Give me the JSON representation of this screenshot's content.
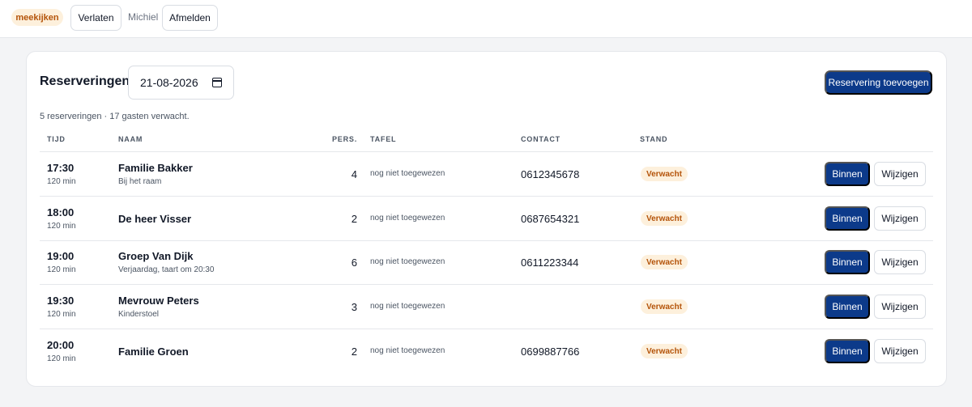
{
  "topbar": {
    "badge": "meekijken",
    "leave_label": "Verlaten",
    "user_name": "Michiel",
    "logout_label": "Afmelden"
  },
  "main": {
    "title": "Reserveringen",
    "date_value": "21-08-2026",
    "add_button": "Reservering toevoegen",
    "summary": "5 reserveringen · 17 gasten verwacht."
  },
  "table": {
    "headers": {
      "time": "TIJD",
      "name": "NAAM",
      "pers": "PERS.",
      "table": "TAFEL",
      "contact": "CONTACT",
      "status": "STAND"
    },
    "rows": [
      {
        "time": "17:30",
        "duration": "120 min",
        "name": "Familie Bakker",
        "note": "Bij het raam",
        "pers": "4",
        "table": "nog niet toegewezen",
        "contact": "0612345678",
        "status": "Verwacht",
        "in_label": "Binnen",
        "edit_label": "Wijzigen"
      },
      {
        "time": "18:00",
        "duration": "120 min",
        "name": "De heer Visser",
        "note": "",
        "pers": "2",
        "table": "nog niet toegewezen",
        "contact": "0687654321",
        "status": "Verwacht",
        "in_label": "Binnen",
        "edit_label": "Wijzigen"
      },
      {
        "time": "19:00",
        "duration": "120 min",
        "name": "Groep Van Dijk",
        "note": "Verjaardag, taart om 20:30",
        "pers": "6",
        "table": "nog niet toegewezen",
        "contact": "0611223344",
        "status": "Verwacht",
        "in_label": "Binnen",
        "edit_label": "Wijzigen"
      },
      {
        "time": "19:30",
        "duration": "120 min",
        "name": "Mevrouw Peters",
        "note": "Kinderstoel",
        "pers": "3",
        "table": "nog niet toegewezen",
        "contact": "",
        "status": "Verwacht",
        "in_label": "Binnen",
        "edit_label": "Wijzigen"
      },
      {
        "time": "20:00",
        "duration": "120 min",
        "name": "Familie Groen",
        "note": "",
        "pers": "2",
        "table": "nog niet toegewezen",
        "contact": "0699887766",
        "status": "Verwacht",
        "in_label": "Binnen",
        "edit_label": "Wijzigen"
      }
    ]
  },
  "icons": {
    "date_picker": "calendar-icon"
  },
  "colors": {
    "primary": "#0c3a8a",
    "status_bg": "#fdf0dc",
    "status_text": "#b45309",
    "page_bg": "#f3f4f6"
  }
}
